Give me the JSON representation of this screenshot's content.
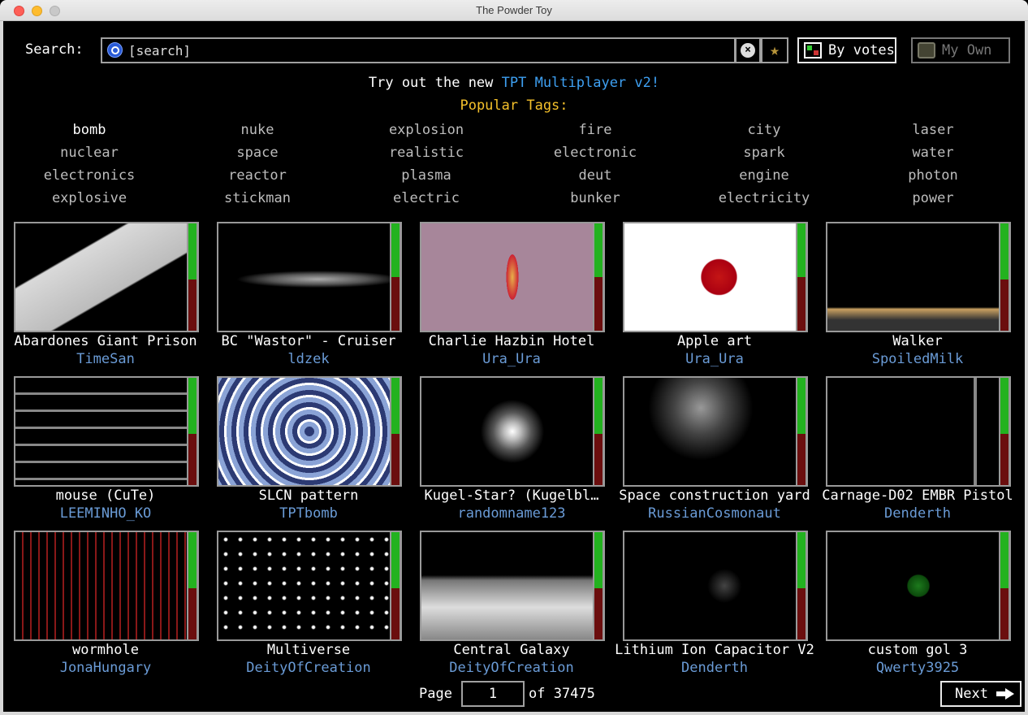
{
  "window": {
    "title": "The Powder Toy"
  },
  "search": {
    "label": "Search:",
    "placeholder": "[search]"
  },
  "toolbar": {
    "by_votes": "By votes",
    "my_own": "My Own"
  },
  "promo": {
    "prefix": "Try out the new ",
    "link": "TPT Multiplayer v2!"
  },
  "tags": {
    "title": "Popular Tags:",
    "items": [
      "bomb",
      "nuke",
      "explosion",
      "fire",
      "city",
      "laser",
      "nuclear",
      "space",
      "realistic",
      "electronic",
      "spark",
      "water",
      "electronics",
      "reactor",
      "plasma",
      "deut",
      "engine",
      "photon",
      "explosive",
      "stickman",
      "electric",
      "bunker",
      "electricity",
      "power"
    ]
  },
  "saves": [
    {
      "title": "Abardones Giant Prison",
      "author": "TimeSan",
      "score": 0.52
    },
    {
      "title": "BC \"Wastor\" - Cruiser",
      "author": "ldzek",
      "score": 0.5
    },
    {
      "title": "Charlie Hazbin Hotel",
      "author": "Ura_Ura",
      "score": 0.5
    },
    {
      "title": "Apple art",
      "author": "Ura_Ura",
      "score": 0.5
    },
    {
      "title": "Walker",
      "author": "SpoiledMilk",
      "score": 0.52
    },
    {
      "title": "mouse (CuTe)",
      "author": "LEEMINHO_KO",
      "score": 0.52
    },
    {
      "title": "SLCN pattern",
      "author": "TPTbomb",
      "score": 0.52
    },
    {
      "title": "Kugel-Star? (Kugelbl…",
      "author": "randomname123",
      "score": 0.52
    },
    {
      "title": "Space construction yard",
      "author": "RussianCosmonaut",
      "score": 0.52
    },
    {
      "title": "Carnage-D02 EMBR Pistol",
      "author": "Denderth",
      "score": 0.52
    },
    {
      "title": "wormhole",
      "author": "JonaHungary",
      "score": 0.52
    },
    {
      "title": "Multiverse",
      "author": "DeityOfCreation",
      "score": 0.52
    },
    {
      "title": "Central Galaxy",
      "author": "DeityOfCreation",
      "score": 0.52
    },
    {
      "title": "Lithium Ion Capacitor V2",
      "author": "Denderth",
      "score": 0.52
    },
    {
      "title": "custom gol 3",
      "author": "Qwerty3925",
      "score": 0.52
    }
  ],
  "pagination": {
    "label": "Page",
    "current": "1",
    "of": "of 37475",
    "next": "Next"
  }
}
